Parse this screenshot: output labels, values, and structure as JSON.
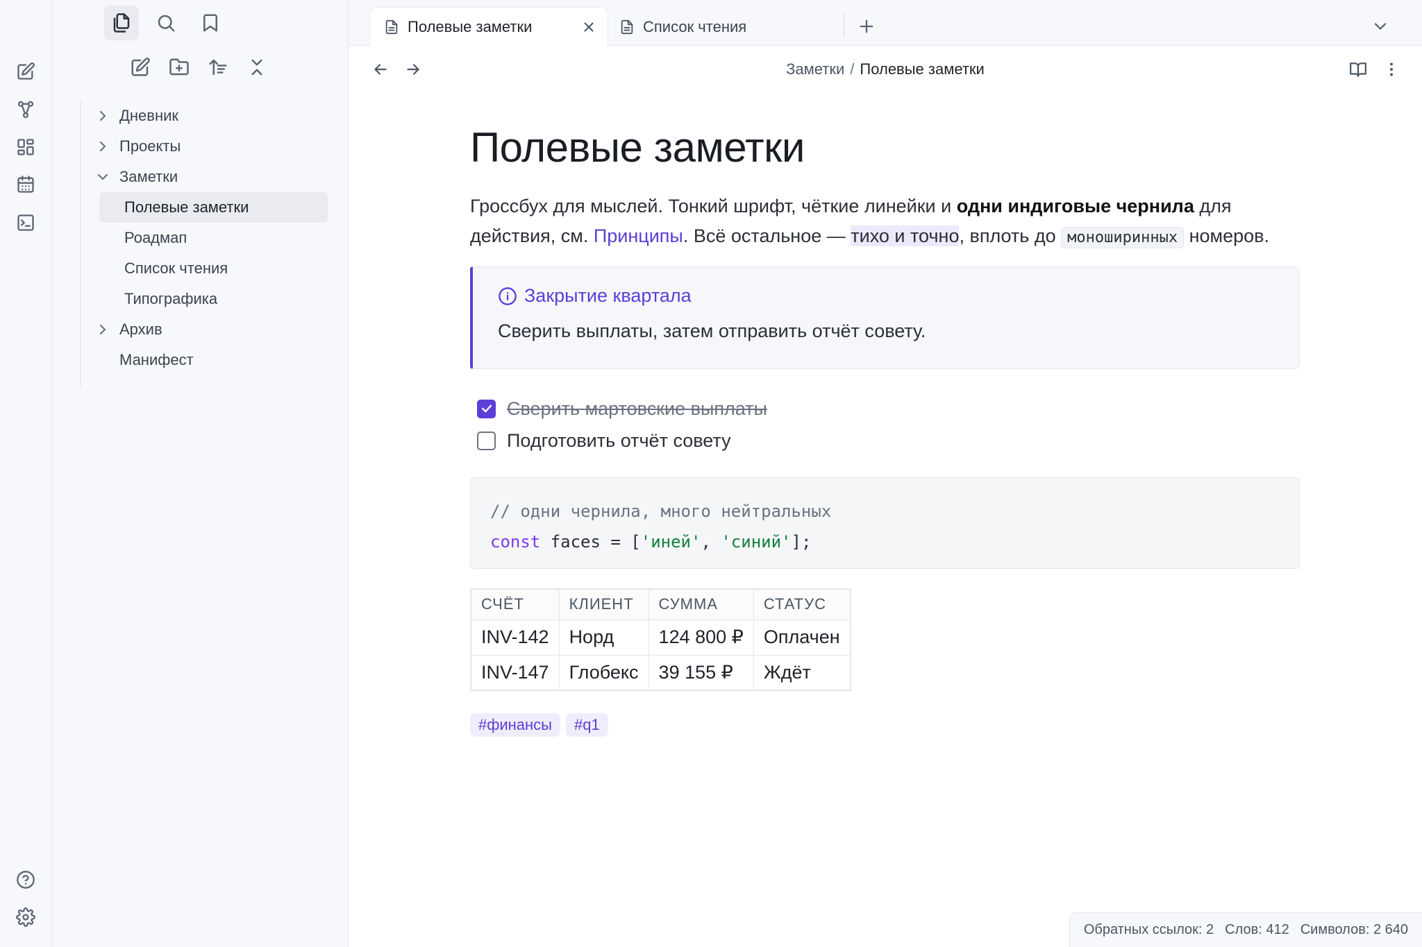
{
  "theme": {
    "accent": "#5b3fd6",
    "panel": "#f7f8fb"
  },
  "ribbon": {
    "top": [
      "new-note-icon",
      "graph-icon",
      "canvas-icon",
      "daily-note-icon",
      "command-palette-icon"
    ],
    "bottom": [
      "help-icon",
      "settings-icon"
    ]
  },
  "sidebar": {
    "header_tabs": [
      "files-icon",
      "search-icon",
      "bookmark-icon"
    ],
    "tools": [
      "new-note-icon",
      "new-folder-icon",
      "sort-icon",
      "collapse-icon"
    ],
    "tree": {
      "diary": "Дневник",
      "projects": "Проекты",
      "notes": "Заметки",
      "notes_children": [
        "Полевые заметки",
        "Роадмап",
        "Список чтения",
        "Типографика"
      ],
      "archive": "Архив",
      "manifest": "Манифест"
    }
  },
  "tabs": [
    {
      "label": "Полевые заметки",
      "active": true
    },
    {
      "label": "Список чтения",
      "active": false
    }
  ],
  "breadcrumb": {
    "parent": "Заметки",
    "separator": "/",
    "current": "Полевые заметки"
  },
  "note": {
    "title": "Полевые заметки",
    "para": {
      "t1": "Гроссбух для мыслей. Тонкий шрифт, чёткие линейки и ",
      "bold": "одни индиговые чернила",
      "t2": " для действия, см. ",
      "link": "Принципы",
      "t3": ". Всё остальное — ",
      "highlight": "тихо и точно",
      "t4": ", вплоть до ",
      "code": "моноширинных",
      "t5": " номеров."
    },
    "callout": {
      "title": "Закрытие квартала",
      "body": "Сверить выплаты, затем отправить отчёт совету."
    },
    "tasks": [
      {
        "label": "Сверить мартовские выплаты",
        "done": true
      },
      {
        "label": "Подготовить отчёт совету",
        "done": false
      }
    ],
    "code": {
      "comment": "// одни чернила, много нейтральных",
      "kw": "const",
      "rest1": " faces = [",
      "s1": "'иней'",
      "comma": ", ",
      "s2": "'синий'",
      "rest2": "];"
    },
    "table": {
      "headers": [
        "СЧЁТ",
        "КЛИЕНТ",
        "СУММА",
        "СТАТУС"
      ],
      "rows": [
        [
          "INV-142",
          "Норд",
          "124 800 ₽",
          "Оплачен"
        ],
        [
          "INV-147",
          "Глобекс",
          "39 155 ₽",
          "Ждёт"
        ]
      ]
    },
    "tags": [
      "#финансы",
      "#q1"
    ]
  },
  "status": {
    "backlinks": "Обратных ссылок: 2",
    "words": "Слов: 412",
    "chars": "Символов: 2 640"
  }
}
